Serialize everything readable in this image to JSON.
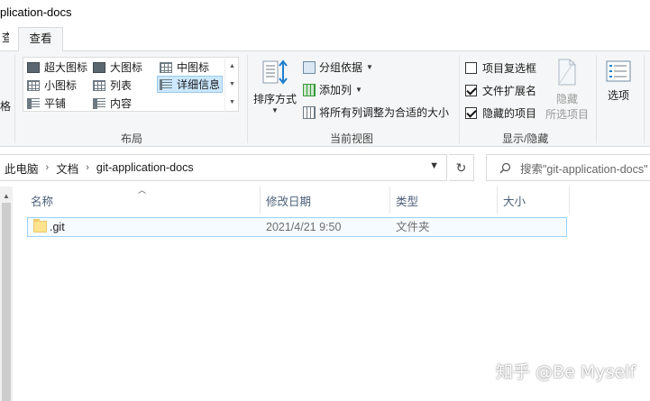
{
  "window": {
    "title": "plication-docs"
  },
  "tabs": [
    {
      "label": "查"
    },
    {
      "label": "查看"
    }
  ],
  "ribbon": {
    "layout_group": {
      "label": "布局",
      "options": [
        {
          "label": "超大图标",
          "icon": "extra-large-icons-icon"
        },
        {
          "label": "大图标",
          "icon": "large-icons-icon"
        },
        {
          "label": "中图标",
          "icon": "medium-icons-icon"
        },
        {
          "label": "小图标",
          "icon": "small-icons-icon"
        },
        {
          "label": "列表",
          "icon": "list-icon"
        },
        {
          "label": "详细信息",
          "icon": "details-icon",
          "selected": true
        },
        {
          "label": "平铺",
          "icon": "tiles-icon"
        },
        {
          "label": "内容",
          "icon": "content-icon"
        }
      ],
      "left_cut_label": "格"
    },
    "current_view_group": {
      "label": "当前视图",
      "sort_label": "排序方式",
      "group_by_label": "分组依据",
      "add_column_label": "添加列",
      "fit_columns_label": "将所有列调整为合适的大小"
    },
    "show_hide_group": {
      "label": "显示/隐藏",
      "checkboxes": [
        {
          "label": "项目复选框",
          "checked": false
        },
        {
          "label": "文件扩展名",
          "checked": true
        },
        {
          "label": "隐藏的项目",
          "checked": true
        }
      ],
      "hide_label": "隐藏",
      "hide_selected_label": "所选项目"
    },
    "options_label": "选项"
  },
  "address_bar": {
    "crumbs": [
      "此电脑",
      "文档",
      "git-application-docs"
    ]
  },
  "search": {
    "placeholder": "搜索\"git-application-docs\""
  },
  "file_list": {
    "columns": [
      "名称",
      "修改日期",
      "类型",
      "大小"
    ],
    "rows": [
      {
        "name": ".git",
        "modified": "2021/4/21 9:50",
        "type": "文件夹",
        "size": ""
      }
    ]
  },
  "watermark": "知乎 @Be Myself",
  "colors": {
    "ribbon_bg": "#f5f6f7",
    "selection_border": "#99d1ff",
    "header_text": "#4c607a",
    "folder_yellow": "#ffe38f"
  }
}
